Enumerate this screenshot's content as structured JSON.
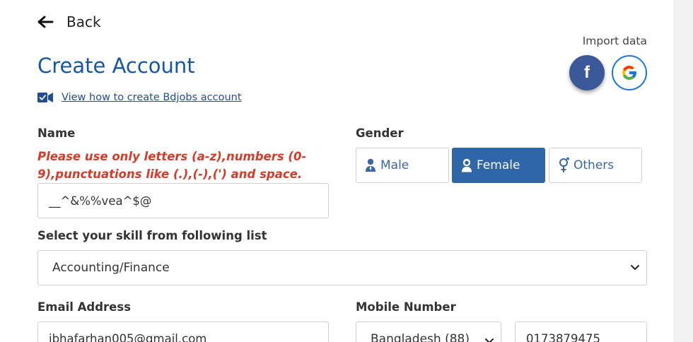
{
  "nav": {
    "back_label": "Back"
  },
  "header": {
    "title": "Create Account",
    "video_link": "View how to create Bdjobs account",
    "import_label": "Import data",
    "facebook_glyph": "f"
  },
  "name_field": {
    "label": "Name",
    "error": "Please use only letters (a-z),numbers (0-9),punctuations like (.),(-),(') and space.",
    "value": "__^&%%vea^$@"
  },
  "gender": {
    "label": "Gender",
    "options": [
      "Male",
      "Female",
      "Others"
    ],
    "selected": "Female"
  },
  "skill": {
    "label": "Select your skill from following list",
    "value": "Accounting/Finance"
  },
  "email": {
    "label": "Email Address",
    "value": "ibhafarhan005@gmail.com"
  },
  "mobile": {
    "label": "Mobile Number",
    "country": "Bangladesh (88)",
    "number": "0173879475"
  },
  "colors": {
    "primary": "#1557a6",
    "selected_bg": "#2f66a8",
    "error": "#d63b2a",
    "facebook": "#3b5998",
    "google_border": "#1a73e8"
  }
}
